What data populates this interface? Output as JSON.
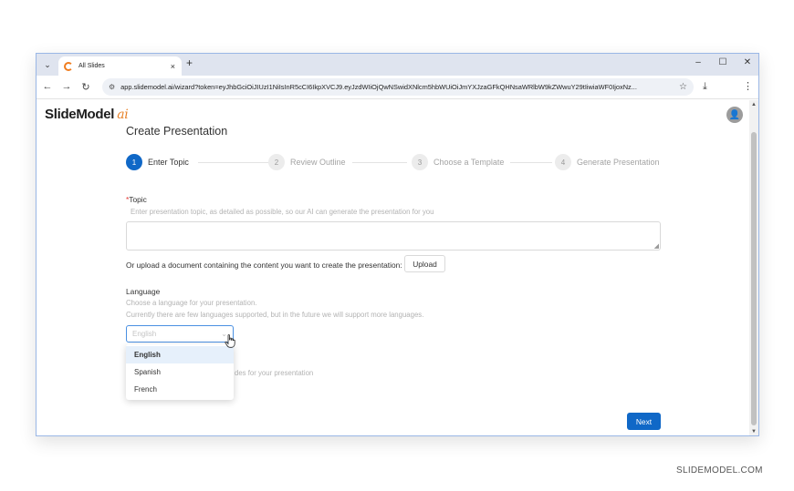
{
  "browser": {
    "tab_title": "All Slides",
    "tab_close": "×",
    "new_tab": "+",
    "tab_search_icon": "⌄",
    "minimize": "–",
    "maximize": "☐",
    "close": "✕",
    "url": "app.slidemodel.ai/wizard?token=eyJhbGciOiJIUzI1NiIsInR5cCI6IkpXVCJ9.eyJzdWIiOjQwNSwidXNlcm5hbWUiOiJmYXJzaGFkQHNsaWRlbW9kZWwuY29tIiwiaWF0IjoxNz...",
    "back": "←",
    "forward": "→",
    "reload": "↻",
    "site_info": "⚙",
    "bookmark": "☆",
    "download": "⤓",
    "menu": "⋮"
  },
  "app": {
    "logo_text": "SlideModel",
    "logo_ai": "ai",
    "avatar_glyph": "👤"
  },
  "wizard": {
    "title": "Create Presentation",
    "steps": [
      {
        "num": "1",
        "label": "Enter Topic"
      },
      {
        "num": "2",
        "label": "Review Outline"
      },
      {
        "num": "3",
        "label": "Choose a Template"
      },
      {
        "num": "4",
        "label": "Generate Presentation"
      }
    ],
    "active_step": 1
  },
  "form": {
    "topic_required_mark": "*",
    "topic_label": "Topic",
    "topic_help": "Enter presentation topic, as detailed as possible, so our AI can generate the presentation for you",
    "upload_text": "Or upload a document containing the content you want to create the presentation:",
    "upload_label": "Upload",
    "language_label": "Language",
    "language_help_1": "Choose a language for your presentation.",
    "language_help_2": "Currently there are few languages supported, but in the future we will support more languages.",
    "language_placeholder": "English",
    "language_options": [
      "English",
      "Spanish",
      "French"
    ],
    "language_selected_index": 0,
    "partial_help": "des for your presentation",
    "next_label": "Next"
  },
  "watermark": "SLIDEMODEL.COM",
  "colors": {
    "accent": "#1068c7",
    "logo_ai": "#e8832a",
    "required": "#e53935"
  }
}
